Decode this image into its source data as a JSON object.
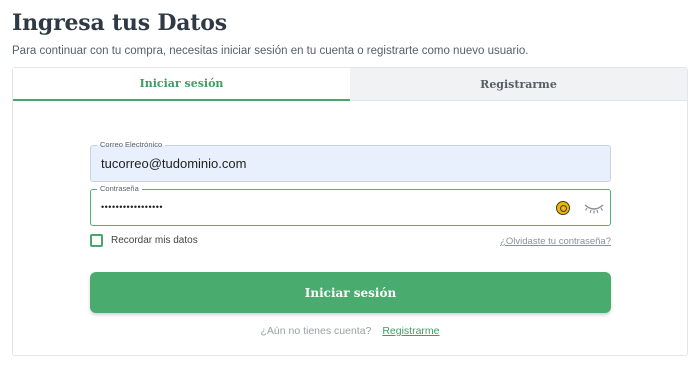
{
  "header": {
    "title": "Ingresa tus Datos",
    "subtitle": "Para continuar con tu compra, necesitas iniciar sesión en tu cuenta o registrarte como nuevo usuario."
  },
  "tabs": [
    {
      "label": "Iniciar sesión",
      "active": true
    },
    {
      "label": "Registrarme",
      "active": false
    }
  ],
  "form": {
    "email_label": "Correo Electrónico",
    "email_value": "tucorreo@tudominio.com",
    "password_label": "Contraseña",
    "password_masked": "•••••••••••••••••",
    "remember_label": "Recordar mis datos",
    "forgot_link": "¿Olvidaste tu contraseña?",
    "submit_label": "Iniciar sesión",
    "remember_checked": false
  },
  "footer": {
    "question": "¿Aún no tienes cuenta?",
    "register_link": "Registrarme"
  },
  "colors": {
    "accent": "#4aab6f",
    "title": "#2f3a45",
    "email_bg": "#e8f0fd",
    "badge": "#f3b600"
  },
  "icons": [
    "password-manager-icon",
    "eye-closed-icon"
  ]
}
